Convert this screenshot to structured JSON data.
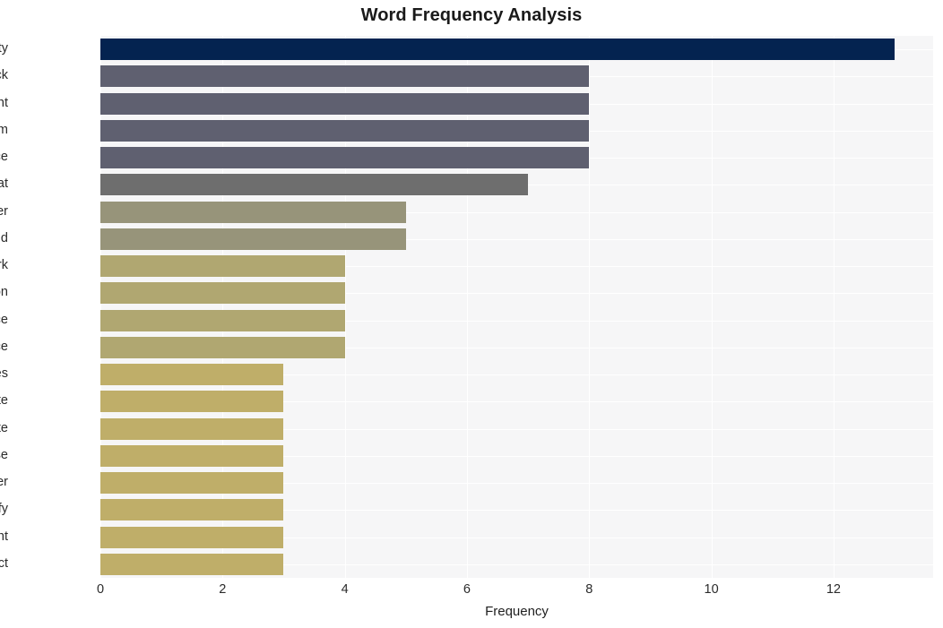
{
  "chart_data": {
    "type": "bar",
    "orientation": "horizontal",
    "title": "Word Frequency Analysis",
    "xlabel": "Frequency",
    "ylabel": "",
    "categories": [
      "security",
      "check",
      "point",
      "quantum",
      "force",
      "threat",
      "power",
      "cloud",
      "network",
      "prevention",
      "performance",
      "enhance",
      "series",
      "sophisticate",
      "automate",
      "response",
      "deliver",
      "unify",
      "management",
      "protect"
    ],
    "values": [
      13,
      8,
      8,
      8,
      8,
      7,
      5,
      5,
      4,
      4,
      4,
      4,
      3,
      3,
      3,
      3,
      3,
      3,
      3,
      3
    ],
    "bar_colors": [
      "#042350",
      "#5f6070",
      "#5f6070",
      "#5f6070",
      "#5f6070",
      "#6e6e6e",
      "#97947a",
      "#97947a",
      "#b0a771",
      "#b0a771",
      "#b0a771",
      "#b0a771",
      "#bfae69",
      "#bfae69",
      "#bfae69",
      "#bfae69",
      "#bfae69",
      "#bfae69",
      "#bfae69",
      "#bfae69"
    ],
    "xlim": [
      0,
      13.63
    ],
    "xticks": [
      0,
      2,
      4,
      6,
      8,
      10,
      12
    ],
    "xtick_labels": [
      "0",
      "2",
      "4",
      "6",
      "8",
      "10",
      "12"
    ],
    "grid": true,
    "grid_color": "#ffffff",
    "plot_background": "#f6f6f7",
    "figure_background": "#ffffff",
    "legend": null
  }
}
